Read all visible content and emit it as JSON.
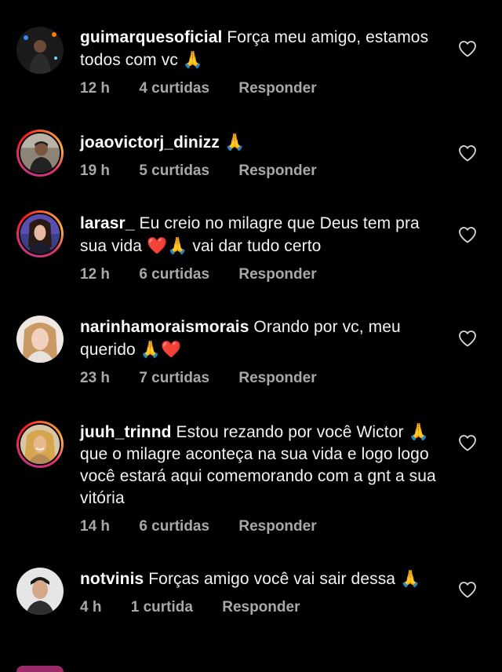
{
  "comments": [
    {
      "username": "guimarquesoficial",
      "text": "Força meu amigo, estamos todos com vc",
      "emoji_after": "🙏",
      "time": "12 h",
      "likes": "4 curtidas",
      "reply": "Responder"
    },
    {
      "username": "joaovictorj_dinizz",
      "text": "",
      "emoji_after": "🙏",
      "time": "19 h",
      "likes": "5 curtidas",
      "reply": "Responder"
    },
    {
      "username": "larasr_",
      "text_before": "Eu creio no milagre que Deus tem pra sua vida",
      "emoji_mid": "❤️🙏",
      "text_after": "vai dar tudo certo",
      "time": "12 h",
      "likes": "6 curtidas",
      "reply": "Responder"
    },
    {
      "username": "narinhamoraismorais",
      "text": "Orando por vc, meu querido",
      "emoji_after": "🙏❤️",
      "time": "23 h",
      "likes": "7 curtidas",
      "reply": "Responder"
    },
    {
      "username": "juuh_trinnd",
      "text_before": "Estou rezando por você Wictor",
      "emoji_mid": "🙏",
      "text_after": "que o milagre aconteça na sua vida e logo logo você estará aqui comemorando com a gnt a sua vitória",
      "time": "14 h",
      "likes": "6 curtidas",
      "reply": "Responder"
    },
    {
      "username": "notvinis",
      "text": "Forças amigo você vai sair dessa",
      "emoji_after": "🙏",
      "time": "4 h",
      "likes": "1 curtida",
      "reply": "Responder"
    }
  ],
  "colors": {
    "background": "#000000",
    "text": "#f2f2f2",
    "meta": "#a8a8a8",
    "story_ring": "#e1306c"
  },
  "icons": {
    "like": "heart-outline-icon"
  }
}
